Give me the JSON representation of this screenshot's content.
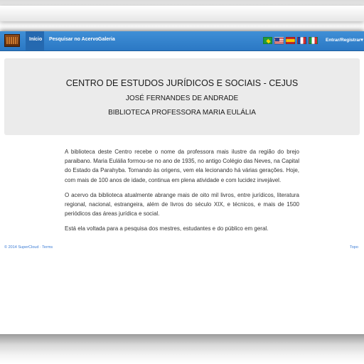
{
  "navbar": {
    "links": [
      "Início",
      "Pesquisar no Acervo",
      "Galeria"
    ],
    "flags": [
      "brazil-flag-icon",
      "usa-flag-icon",
      "spain-flag-icon",
      "france-flag-icon",
      "italy-flag-icon"
    ],
    "login_label": "Entrar/Registrar▾",
    "accent_color": "#2b78c4"
  },
  "hero": {
    "title": "CENTRO DE ESTUDOS JURÍDICOS E SOCIAIS - CEJUS",
    "subtitle": "JOSÉ FERNANDES DE ANDRADE",
    "subtitle2": "BIBLIOTECA PROFESSORA MARIA EULÁLIA"
  },
  "content": {
    "paragraphs": [
      "A biblioteca deste Centro recebe o nome da professora mais ilustre da região do brejo paraibano. Maria Eulália formou-se no ano de 1935, no antigo Colégio das Neves, na Capital do Estado da Parahyba. Tornando às origens, vem ela lecionando há várias gerações. Hoje, com mais de 100 anos de idade, continua em plena atividade e com lucidez invejável.",
      "O acervo da biblioteca atualmente abrange mais de oito mil livros, entre jurídicos, literatura regional, nacional, estrangeira, além de livros do século XIX, e técnicos, e mais de 1500 periódicos das áreas jurídica e social.",
      "Está ela voltada para a pesquisa dos mestres, estudantes e do público em geral."
    ]
  },
  "footer": {
    "copyright": "© 2014 SuperCloud · Terms",
    "top_link": "Topo"
  }
}
